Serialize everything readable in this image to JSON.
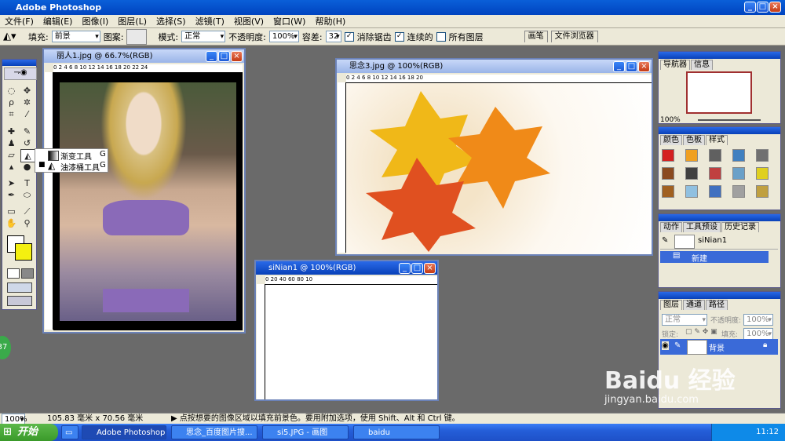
{
  "app": {
    "title": "Adobe Photoshop"
  },
  "menu": [
    "文件(F)",
    "编辑(E)",
    "图像(I)",
    "图层(L)",
    "选择(S)",
    "滤镜(T)",
    "视图(V)",
    "窗口(W)",
    "帮助(H)"
  ],
  "options": {
    "fill_label": "填充:",
    "fill_value": "前景",
    "pattern_label": "图案:",
    "mode_label": "模式:",
    "mode_value": "正常",
    "opacity_label": "不透明度:",
    "opacity_value": "100%",
    "tolerance_label": "容差:",
    "tolerance_value": "32",
    "antialias_label": "消除锯齿",
    "contiguous_label": "连续的",
    "all_layers_label": "所有图层",
    "tab_brush": "画笔",
    "tab_browser": "文件浏览器"
  },
  "flyout": {
    "items": [
      {
        "label": "渐变工具",
        "key": "G"
      },
      {
        "label": "油漆桶工具",
        "key": "G"
      }
    ]
  },
  "doc1": {
    "title": "丽人1.jpg @ 66.7%(RGB)"
  },
  "doc2": {
    "title": "思念3.jpg @ 100%(RGB)"
  },
  "doc3": {
    "title": "siNian1 @ 100%(RGB)"
  },
  "ruler": {
    "h1": "0   2   4   6   8   10   12   14   16   18   20   22   24",
    "h2": "0      2      4      6      8      10      12      14      16      18      20",
    "h3": "0      20      40      60      80      10"
  },
  "nav": {
    "tab1": "导航器",
    "tab2": "信息",
    "zoom": "100%"
  },
  "color": {
    "tab1": "颜色",
    "tab2": "色板",
    "tab3": "样式",
    "swatches": [
      "#d42020",
      "#f0a020",
      "#606060",
      "#4080c0",
      "#707070",
      "#8a4a20",
      "#404040",
      "#c04040",
      "#6aa0c8",
      "#e0d020",
      "#a06020",
      "#90c0e0",
      "#4070c0",
      "#a0a0a0",
      "#c0a040"
    ]
  },
  "history": {
    "tab1": "动作",
    "tab2": "工具预设",
    "tab3": "历史记录",
    "doc": "siNian1",
    "item": "新建"
  },
  "layers": {
    "tab1": "图层",
    "tab2": "通道",
    "tab3": "路径",
    "mode": "正常",
    "opacity_label": "不透明度:",
    "opacity": "100%",
    "lock_label": "锁定:",
    "fill_label": "填充:",
    "fill": "100%",
    "layer": "背景"
  },
  "status": {
    "zoom": "100%",
    "size": "105.83 毫米 x 70.56 毫米",
    "hint": "▶  点按想要的图像区域以填充前景色。要用附加选项，使用 Shift、Alt 和 Ctrl 键。"
  },
  "badge": "37",
  "watermark": {
    "line1": "Baidu 经验",
    "line2": "jingyan.baidu.com"
  },
  "taskbar": {
    "start": "开始",
    "tasks": [
      "Adobe Photoshop",
      "思念_百度图片搜...",
      "si5.JPG - 画图",
      "baidu"
    ],
    "time": "11:12"
  }
}
